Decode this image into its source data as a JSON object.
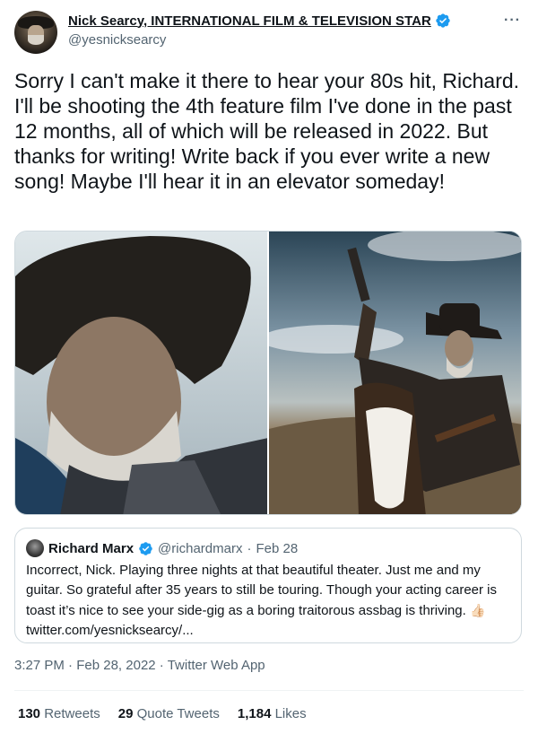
{
  "author": {
    "display_name": "Nick Searcy, INTERNATIONAL FILM & TELEVISION STAR",
    "handle": "@yesnicksearcy",
    "verified": true,
    "avatar_icon": "profile-photo"
  },
  "more_icon": "···",
  "tweet": {
    "text": "Sorry I can't make it there to hear your 80s hit, Richard.  I'll be shooting the 4th feature film I've done in the past 12 months, all of which will be released in 2022.  But thanks for writing! Write back if you ever write a new song! Maybe I'll hear it in an elevator someday!"
  },
  "media": {
    "photos": [
      "cowboy-closeup-photo",
      "cowboy-on-horse-photo"
    ]
  },
  "quoted_tweet": {
    "name": "Richard Marx",
    "handle": "@richardmarx",
    "separator": "·",
    "date": "Feb 28",
    "verified": true,
    "text": "Incorrect, Nick. Playing three nights at that beautiful theater. Just me and my guitar. So grateful after 35 years to still be touring. Though your acting career is toast it’s nice to see your side-gig as a boring traitorous assbag is thriving.",
    "emoji": "👍🏻",
    "link": "twitter.com/yesnicksearcy/..."
  },
  "meta": {
    "time": "3:27 PM",
    "separator": "·",
    "date": "Feb 28, 2022",
    "app": "Twitter Web App"
  },
  "stats": {
    "retweets_count": "130",
    "retweets_label": "Retweets",
    "quotes_count": "29",
    "quotes_label": "Quote Tweets",
    "likes_count": "1,184",
    "likes_label": "Likes"
  },
  "colors": {
    "verified": "#1d9bf0",
    "secondary_text": "#536471",
    "border": "#cfd9de"
  }
}
